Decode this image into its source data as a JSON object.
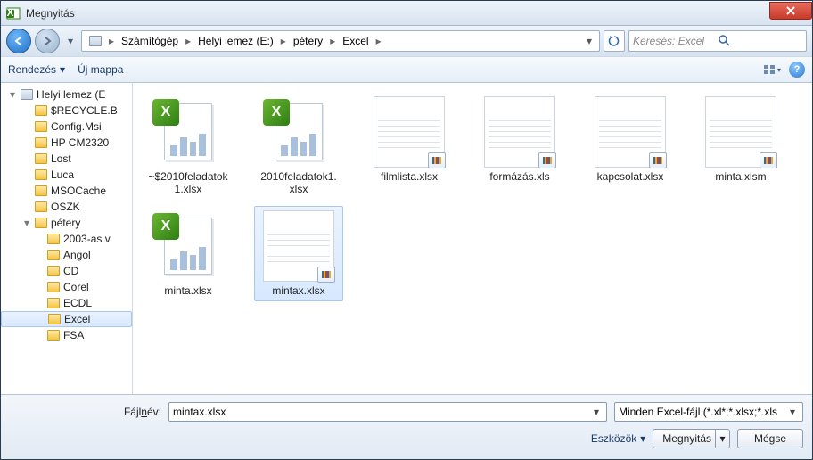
{
  "window": {
    "title": "Megnyitás"
  },
  "breadcrumb": {
    "items": [
      "Számítógép",
      "Helyi lemez (E:)",
      "pétery",
      "Excel"
    ]
  },
  "search": {
    "placeholder": "Keresés: Excel"
  },
  "toolbar": {
    "organize": "Rendezés",
    "new_folder": "Új mappa"
  },
  "tree": {
    "root": "Helyi lemez (E",
    "items": [
      "$RECYCLE.B",
      "Config.Msi",
      "HP CM2320",
      "Lost",
      "Luca",
      "MSOCache",
      "OSZK",
      "pétery"
    ],
    "sub": [
      "2003-as v",
      "Angol",
      "CD",
      "Corel",
      "ECDL",
      "Excel",
      "FSA"
    ],
    "active": "Excel"
  },
  "files": [
    {
      "name": "~$2010feladatok1.xlsx",
      "kind": "excel-app"
    },
    {
      "name": "2010feladatok1.xlsx",
      "kind": "excel-app"
    },
    {
      "name": "filmlista.xlsx",
      "kind": "preview"
    },
    {
      "name": "formázás.xls",
      "kind": "preview"
    },
    {
      "name": "kapcsolat.xlsx",
      "kind": "preview"
    },
    {
      "name": "minta.xlsm",
      "kind": "preview"
    },
    {
      "name": "minta.xlsx",
      "kind": "excel-app"
    },
    {
      "name": "mintax.xlsx",
      "kind": "preview",
      "selected": true
    }
  ],
  "footer": {
    "filename_label": "Fájlnév:",
    "filename_value": "mintax.xlsx",
    "filter_value": "Minden Excel-fájl (*.xl*;*.xlsx;*.xls",
    "tools": "Eszközök",
    "open": "Megnyitás",
    "cancel": "Mégse"
  }
}
